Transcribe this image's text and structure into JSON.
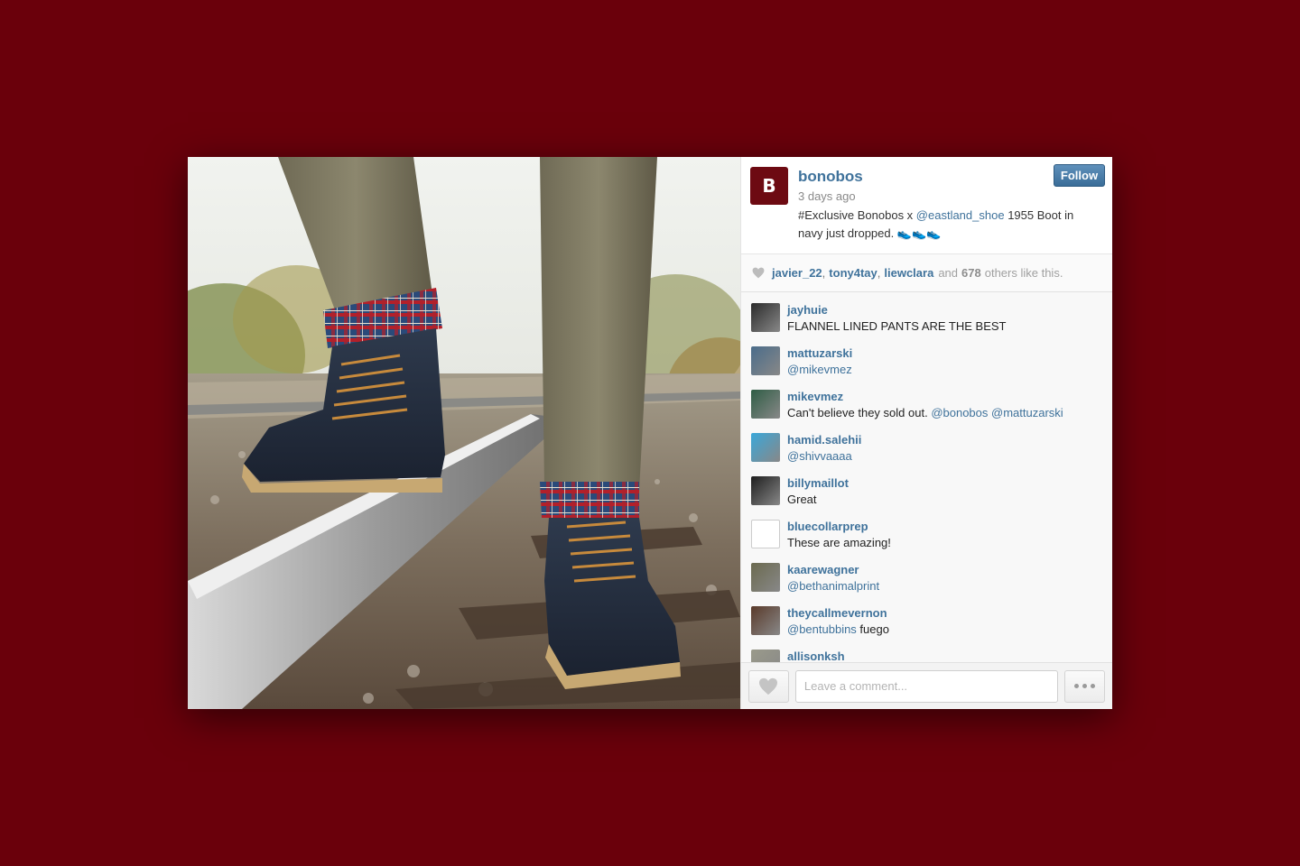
{
  "post": {
    "owner": {
      "username": "bonobos",
      "avatar_letter": "B",
      "avatar_color": "#6d0a12"
    },
    "follow_label": "Follow",
    "time": "3 days ago",
    "caption": {
      "before": "#Exclusive Bonobos x ",
      "mention": "@eastland_shoe",
      "after": " 1955 Boot in navy just dropped. 👟👟👟"
    },
    "photo_alt": "Navy leather boots with flannel-lined cuffed pants on railroad tracks"
  },
  "likes": {
    "users": [
      "javier_22",
      "tony4tay",
      "liewclara"
    ],
    "separator": ",",
    "and_text": "and",
    "count": "678",
    "suffix": "others like this."
  },
  "comments": [
    {
      "user": "jayhuie",
      "parts": [
        {
          "t": "FLANNEL LINED PANTS ARE THE BEST",
          "m": false
        }
      ],
      "avatar_color": "#2b2b2b"
    },
    {
      "user": "mattuzarski",
      "parts": [
        {
          "t": "@mikevmez",
          "m": true
        }
      ],
      "avatar_color": "#4a6c8a"
    },
    {
      "user": "mikevmez",
      "parts": [
        {
          "t": "Can't believe they sold out. ",
          "m": false
        },
        {
          "t": "@bonobos",
          "m": true
        },
        {
          "t": " ",
          "m": false
        },
        {
          "t": "@mattuzarski",
          "m": true
        }
      ],
      "avatar_color": "#2f5d45"
    },
    {
      "user": "hamid.salehii",
      "parts": [
        {
          "t": "@shivvaaaa",
          "m": true
        }
      ],
      "avatar_color": "#3aa7d9"
    },
    {
      "user": "billymaillot",
      "parts": [
        {
          "t": "Great",
          "m": false
        }
      ],
      "avatar_color": "#1e1e1e"
    },
    {
      "user": "bluecollarprep",
      "parts": [
        {
          "t": "These are amazing!",
          "m": false
        }
      ],
      "avatar_color": "#ffffff"
    },
    {
      "user": "kaarewagner",
      "parts": [
        {
          "t": "@bethanimalprint",
          "m": true
        }
      ],
      "avatar_color": "#6b6a4f"
    },
    {
      "user": "theycallmevernon",
      "parts": [
        {
          "t": "@bentubbins",
          "m": true
        },
        {
          "t": " fuego",
          "m": false
        }
      ],
      "avatar_color": "#5a3a2a"
    },
    {
      "user": "allisonksh",
      "parts": [],
      "avatar_color": "#9a9a8a"
    }
  ],
  "footer": {
    "comment_placeholder": "Leave a comment..."
  },
  "colors": {
    "background": "#6a000b",
    "link": "#3f729b",
    "follow_button": "#4a7fab"
  }
}
